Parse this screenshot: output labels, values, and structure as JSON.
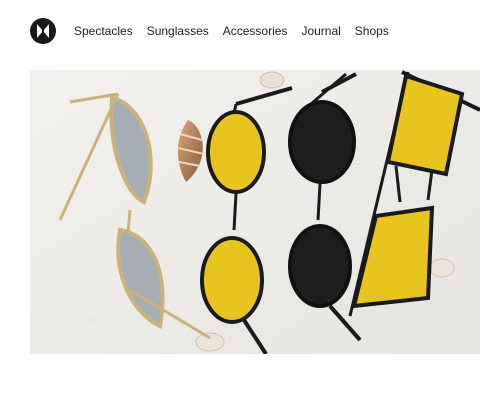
{
  "brand": {
    "logo_icon": "brand-monogram-icon"
  },
  "nav": {
    "items": [
      {
        "label": "Spectacles"
      },
      {
        "label": "Sunglasses"
      },
      {
        "label": "Accessories"
      },
      {
        "label": "Journal"
      },
      {
        "label": "Shops"
      }
    ]
  },
  "hero": {
    "subject": "sunglasses-on-sand-photo",
    "colors": {
      "sand": "#eeedea",
      "lens_yellow": "#e8c51e",
      "lens_black": "#1e1e1e",
      "lens_gray": "#a6adb5",
      "frame_gold": "#cbb27a",
      "frame_black": "#1a1a1a"
    }
  }
}
